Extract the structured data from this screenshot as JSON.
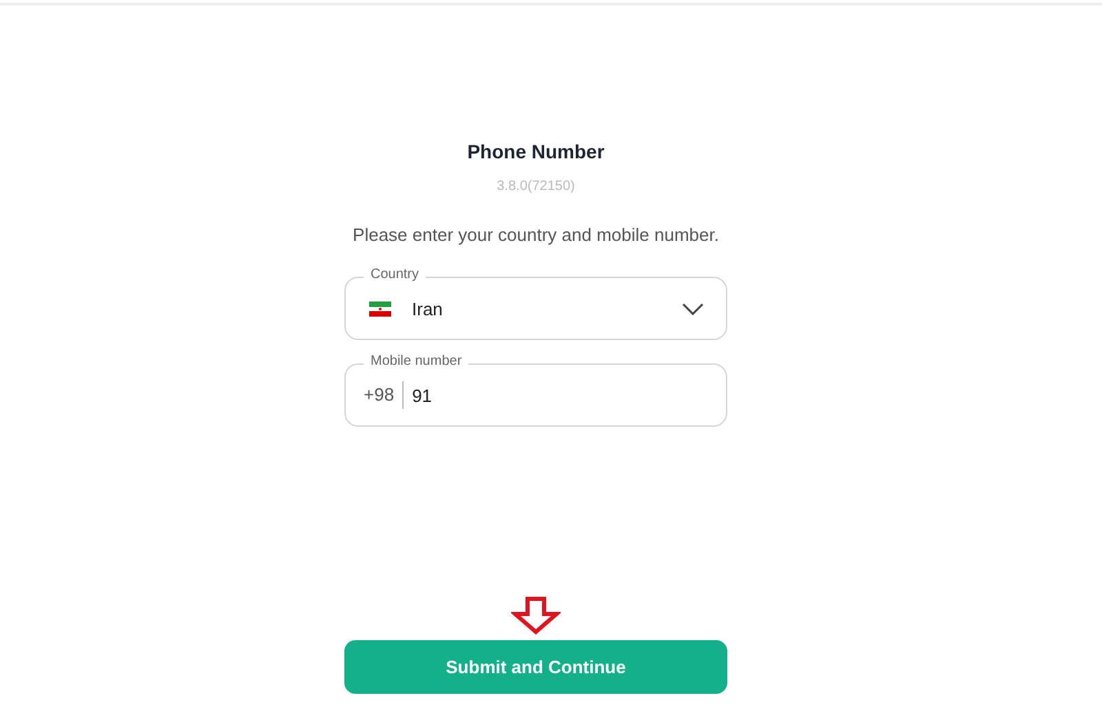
{
  "title": "Phone Number",
  "version": "3.8.0(72150)",
  "instruction": "Please enter your country and mobile number.",
  "country_field": {
    "label": "Country",
    "value": "Iran"
  },
  "mobile_field": {
    "label": "Mobile number",
    "prefix": "+98",
    "value": "91"
  },
  "submit_button": {
    "label": "Submit and Continue"
  }
}
